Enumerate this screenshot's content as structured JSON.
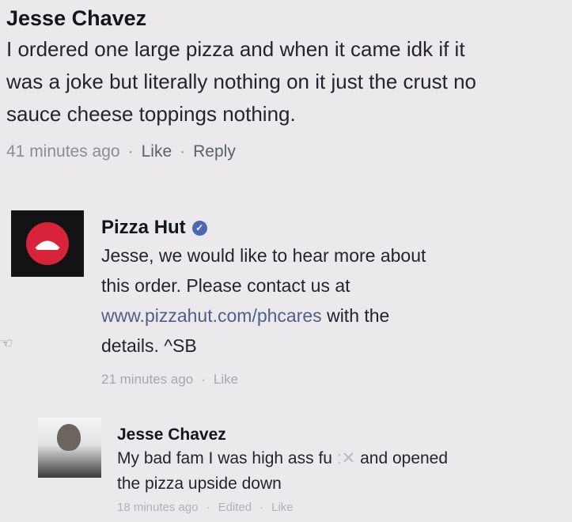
{
  "comments": [
    {
      "author": "Jesse Chavez",
      "lines": [
        "I ordered one large pizza and when it came idk if it",
        "was a joke but literally nothing on it just the crust no",
        "sauce cheese toppings nothing."
      ],
      "time": "41 minutes ago",
      "actions": [
        "Like",
        "Reply"
      ]
    },
    {
      "author": "Pizza Hut",
      "verified_icon": "check-icon",
      "lines": [
        "Jesse, we would like to hear more about",
        "this order. Please contact us at"
      ],
      "link": "www.pizzahut.com/phcares",
      "link_suffix": " with the",
      "last_line": "details. ^SB",
      "time": "21 minutes ago",
      "actions": [
        "Like"
      ]
    },
    {
      "author": "Jesse Chavez",
      "lines": [
        "My bad fam I was high ass fu",
        "and opened",
        "the pizza upside down"
      ],
      "time": "18 minutes ago",
      "edited": "Edited",
      "actions": [
        "Like"
      ]
    }
  ],
  "colors": {
    "background": "#ece9ec",
    "brand_red": "#d8243a",
    "verified_blue": "#4a68b4",
    "link": "#4e5f8a"
  }
}
